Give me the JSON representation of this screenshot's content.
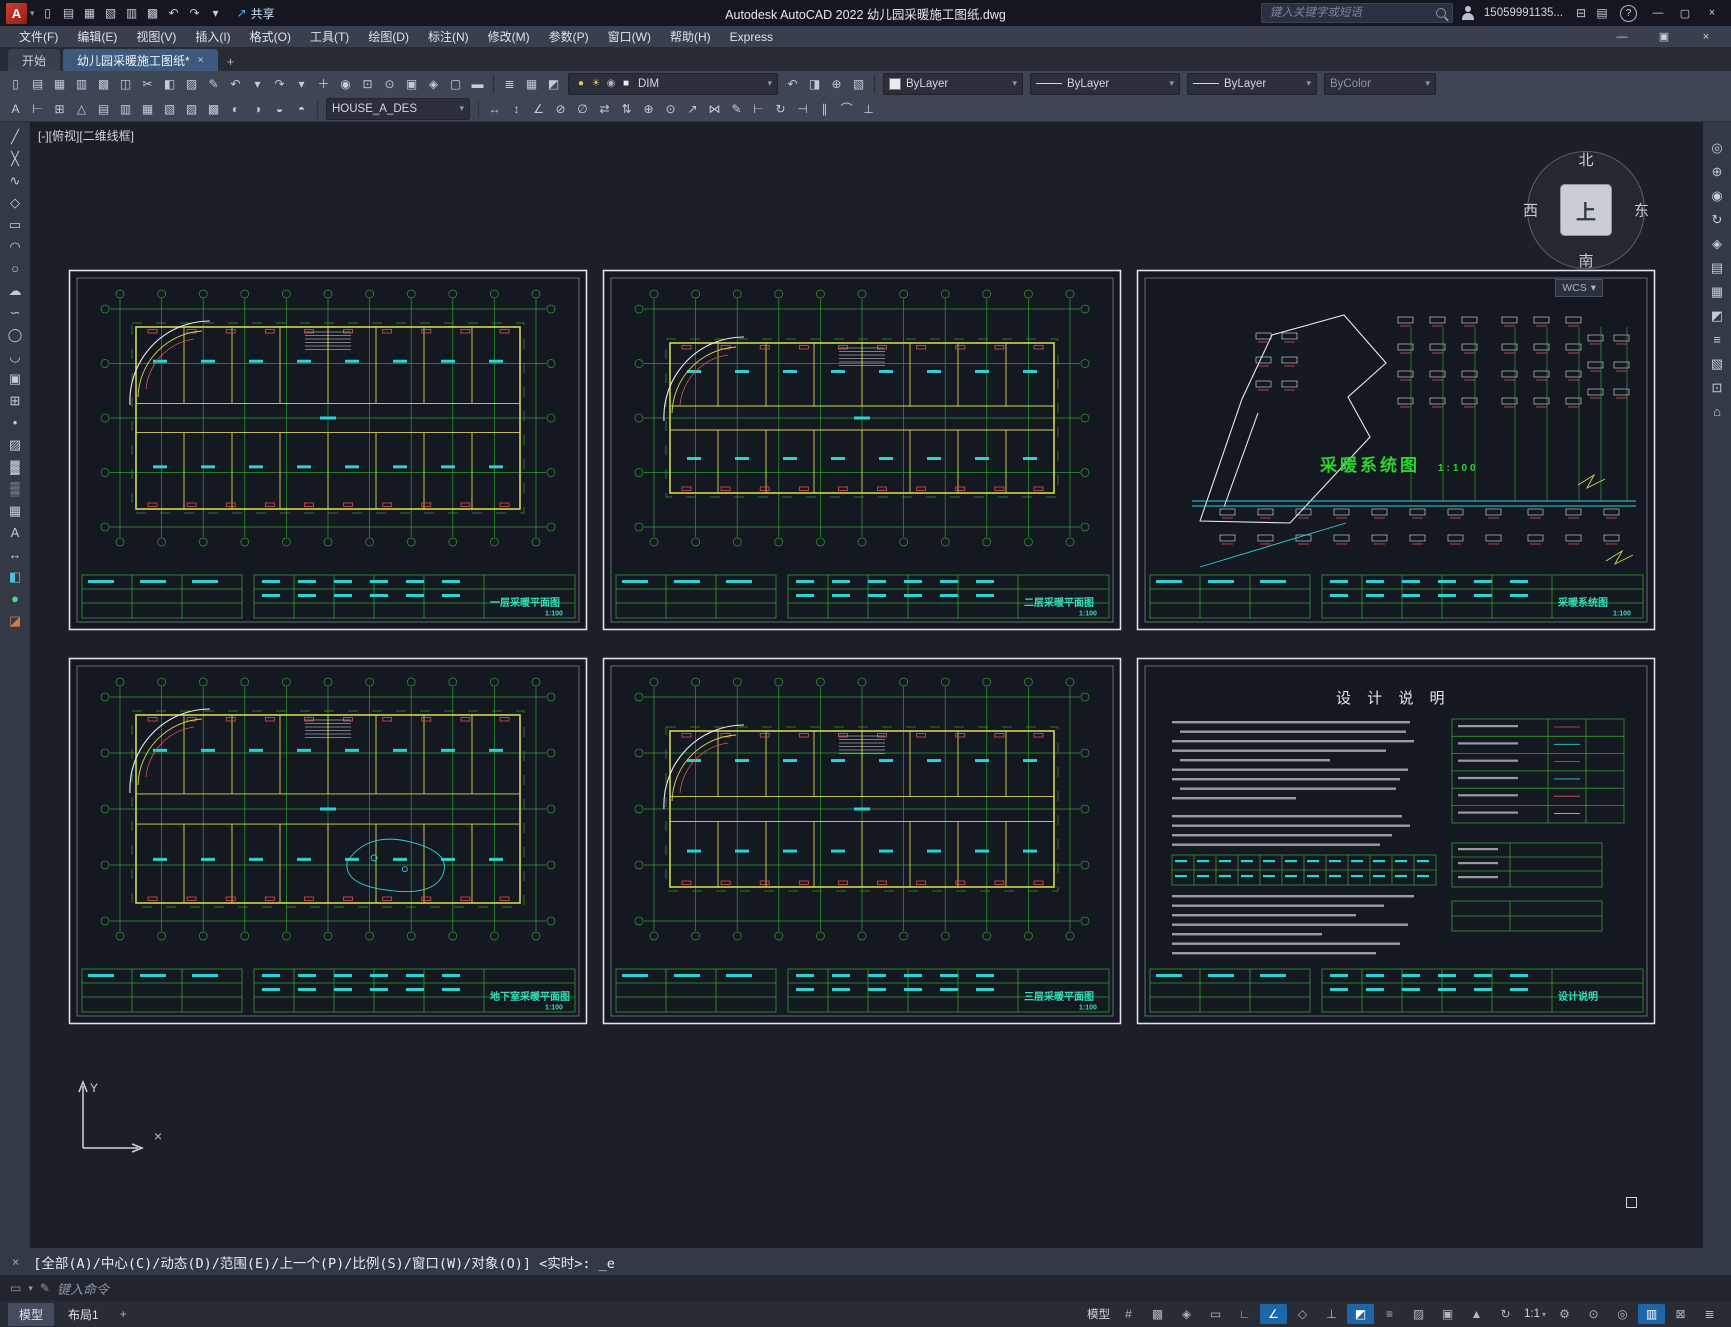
{
  "titlebar": {
    "logo": "A",
    "quick_access": [
      {
        "n": "new-file-icon",
        "g": "▯"
      },
      {
        "n": "open-file-icon",
        "g": "▤"
      },
      {
        "n": "save-icon",
        "g": "▦"
      },
      {
        "n": "save-as-icon",
        "g": "▧"
      },
      {
        "n": "plot-icon",
        "g": "▥"
      },
      {
        "n": "plot-preview-icon",
        "g": "▩"
      },
      {
        "n": "undo-icon",
        "g": "↶"
      },
      {
        "n": "redo-icon",
        "g": "↷"
      },
      {
        "n": "quick-access-dropdown-icon",
        "g": "▾"
      }
    ],
    "share_label": "共享",
    "title": "Autodesk AutoCAD 2022   幼儿园采暖施工图纸.dwg",
    "search_placeholder": "键入关键字或短语",
    "account": "15059991135...",
    "help": "?",
    "extra_icons": [
      {
        "n": "cart-icon",
        "g": "⊟"
      },
      {
        "n": "apps-icon",
        "g": "▤"
      }
    ],
    "window_icons": [
      {
        "n": "window-minimize-icon",
        "g": "—"
      },
      {
        "n": "window-maximize-icon",
        "g": "▢"
      },
      {
        "n": "window-close-icon",
        "g": "×"
      }
    ]
  },
  "menubar": {
    "items": [
      "文件(F)",
      "编辑(E)",
      "视图(V)",
      "插入(I)",
      "格式(O)",
      "工具(T)",
      "绘图(D)",
      "标注(N)",
      "修改(M)",
      "参数(P)",
      "窗口(W)",
      "帮助(H)",
      "Express"
    ],
    "docwin_icons": [
      {
        "n": "doc-minimize-icon",
        "g": "—"
      },
      {
        "n": "doc-restore-icon",
        "g": "▣"
      },
      {
        "n": "doc-close-icon",
        "g": "×"
      }
    ]
  },
  "filetabs": {
    "start": "开始",
    "doc": "幼儿园采暖施工图纸*",
    "close": "×",
    "add": "+"
  },
  "toolbars": {
    "row1_group1": [
      {
        "n": "qnew-icon",
        "g": "▯"
      },
      {
        "n": "open-icon",
        "g": "▤"
      },
      {
        "n": "qsave-icon",
        "g": "▦"
      },
      {
        "n": "plot-icon",
        "g": "▥"
      },
      {
        "n": "plot-preview-icon",
        "g": "▩"
      },
      {
        "n": "publish-icon",
        "g": "◫"
      },
      {
        "n": "cut-icon",
        "g": "✂"
      },
      {
        "n": "copy-icon",
        "g": "◧"
      },
      {
        "n": "paste-icon",
        "g": "▨"
      },
      {
        "n": "match-properties-icon",
        "g": "✎"
      },
      {
        "n": "undo-icon",
        "g": "↶"
      },
      {
        "n": "undo-dropdown-icon",
        "g": "▾"
      },
      {
        "n": "redo-icon",
        "g": "↷"
      },
      {
        "n": "redo-dropdown-icon",
        "g": "▾"
      },
      {
        "n": "pan-icon",
        "g": "＋"
      },
      {
        "n": "zoom-realtime-icon",
        "g": "◉"
      },
      {
        "n": "zoom-window-icon",
        "g": "⊡"
      },
      {
        "n": "zoom-previous-icon",
        "g": "⊙"
      },
      {
        "n": "properties-palette-icon",
        "g": "▣"
      },
      {
        "n": "design-center-icon",
        "g": "◈"
      },
      {
        "n": "tool-palettes-icon",
        "g": "▢"
      },
      {
        "n": "sheet-set-manager-icon",
        "g": "▬"
      }
    ],
    "row1_group2": [
      {
        "n": "layer-properties-icon",
        "g": "≣"
      },
      {
        "n": "layer-states-icon",
        "g": "▦"
      },
      {
        "n": "layer-isolate-icon",
        "g": "◩"
      }
    ],
    "layer_field": {
      "layer": "DIM",
      "icons": [
        {
          "n": "layer-on-icon",
          "g": "●",
          "c": "#e8c84a"
        },
        {
          "n": "layer-sun-icon",
          "g": "☀",
          "c": "#e8c84a"
        },
        {
          "n": "layer-lock-icon",
          "g": "◉",
          "c": "#aab2bf"
        },
        {
          "n": "layer-color-swatch",
          "g": "■",
          "c": "#e8eaec"
        }
      ]
    },
    "row1_group3": [
      {
        "n": "layer-previous-icon",
        "g": "↶"
      },
      {
        "n": "layer-unlock-icon",
        "g": "◨"
      },
      {
        "n": "make-current-layer-icon",
        "g": "⊕"
      },
      {
        "n": "layer-walk-icon",
        "g": "▧"
      }
    ],
    "properties": {
      "color": "ByLayer",
      "linetype": "ByLayer",
      "lineweight": "ByLayer",
      "plotstyle": "ByColor"
    },
    "row2_group1": [
      {
        "n": "text-style-icon",
        "g": "A"
      },
      {
        "n": "dimension-style-icon",
        "g": "⊢"
      },
      {
        "n": "table-style-icon",
        "g": "⊞"
      },
      {
        "n": "multileader-style-icon",
        "g": "△"
      },
      {
        "n": "point-style-icon",
        "g": "▤"
      },
      {
        "n": "region-icon",
        "g": "▥"
      },
      {
        "n": "boundary-icon",
        "g": "▦"
      },
      {
        "n": "group-icon",
        "g": "▧"
      },
      {
        "n": "ungroup-icon",
        "g": "▨"
      },
      {
        "n": "measure-icon",
        "g": "▩"
      },
      {
        "n": "divide-icon",
        "g": "◐"
      },
      {
        "n": "array-icon",
        "g": "◑"
      },
      {
        "n": "offset-icon",
        "g": "◒"
      },
      {
        "n": "mirror-icon",
        "g": "◓"
      }
    ],
    "style_field": {
      "value": "HOUSE_A_DES"
    },
    "row2_group2": [
      {
        "n": "dimension-linear-icon",
        "g": "↔"
      },
      {
        "n": "dimension-aligned-icon",
        "g": "↕"
      },
      {
        "n": "dimension-angular-icon",
        "g": "∠"
      },
      {
        "n": "dimension-radius-icon",
        "g": "⊘"
      },
      {
        "n": "dimension-diameter-icon",
        "g": "∅"
      },
      {
        "n": "dimension-continue-icon",
        "g": "⇄"
      },
      {
        "n": "dimension-baseline-icon",
        "g": "⇅"
      },
      {
        "n": "tolerance-icon",
        "g": "⊕"
      },
      {
        "n": "center-mark-icon",
        "g": "⊙"
      },
      {
        "n": "leader-icon",
        "g": "↗"
      },
      {
        "n": "quick-dimension-icon",
        "g": "⋈"
      },
      {
        "n": "dimension-edit-icon",
        "g": "✎"
      },
      {
        "n": "dimension-text-edit-icon",
        "g": "⊢"
      },
      {
        "n": "dimension-update-icon",
        "g": "↻"
      },
      {
        "n": "dimension-break-icon",
        "g": "⊣"
      },
      {
        "n": "dimension-space-icon",
        "g": "∥"
      },
      {
        "n": "jogged-dimension-icon",
        "g": "⌒"
      },
      {
        "n": "inspect-dimension-icon",
        "g": "⊥"
      }
    ]
  },
  "left_toolbar": [
    {
      "n": "line-icon",
      "g": "╱"
    },
    {
      "n": "construction-line-icon",
      "g": "╳"
    },
    {
      "n": "polyline-icon",
      "g": "∿"
    },
    {
      "n": "polygon-icon",
      "g": "◇"
    },
    {
      "n": "rectangle-icon",
      "g": "▭"
    },
    {
      "n": "arc-icon",
      "g": "◠"
    },
    {
      "n": "circle-icon",
      "g": "○"
    },
    {
      "n": "revision-cloud-icon",
      "g": "☁"
    },
    {
      "n": "spline-icon",
      "g": "∽"
    },
    {
      "n": "ellipse-icon",
      "g": "◯"
    },
    {
      "n": "ellipse-arc-icon",
      "g": "◡"
    },
    {
      "n": "insert-block-icon",
      "g": "▣"
    },
    {
      "n": "create-block-icon",
      "g": "⊞"
    },
    {
      "n": "point-icon",
      "g": "•"
    },
    {
      "n": "hatch-icon",
      "g": "▨"
    },
    {
      "n": "gradient-icon",
      "g": "▓"
    },
    {
      "n": "region-icon",
      "g": "▒"
    },
    {
      "n": "table-icon",
      "g": "▦"
    },
    {
      "n": "multiline-text-icon",
      "g": "A"
    },
    {
      "n": "dimension-icon",
      "g": "↔"
    },
    {
      "n": "palette-icon",
      "g": "◧",
      "c": "#49c0d8"
    },
    {
      "n": "marker-icon",
      "g": "●",
      "c": "#49d87e"
    },
    {
      "n": "eraser-icon",
      "g": "◪",
      "c": "#d87a49"
    }
  ],
  "right_toolbar": [
    {
      "n": "steering-wheel-icon",
      "g": "◎"
    },
    {
      "n": "pan-hand-icon",
      "g": "⊕"
    },
    {
      "n": "zoom-icon",
      "g": "◉"
    },
    {
      "n": "orbit-icon",
      "g": "↻"
    },
    {
      "n": "show-motion-icon",
      "g": "◈"
    },
    {
      "n": "named-views-icon",
      "g": "▤"
    },
    {
      "n": "view-controls-icon",
      "g": "▦"
    },
    {
      "n": "anchor-left-icon",
      "g": "◩"
    },
    {
      "n": "overflow-icon",
      "g": "≡"
    },
    {
      "n": "layer-panel-icon",
      "g": "▧"
    },
    {
      "n": "grid-display-icon",
      "g": "⊡"
    },
    {
      "n": "home-view-icon",
      "g": "⌂"
    }
  ],
  "canvas": {
    "viewport_label": "[-][俯视][二维线框]",
    "compass": {
      "n": "北",
      "s": "南",
      "e": "东",
      "w": "西",
      "top": "上",
      "wcs": "WCS"
    },
    "ucs_y": "Y",
    "crosshair": "×"
  },
  "drawings": {
    "panels": [
      {
        "id": "plan-1f",
        "type": "plan",
        "title": "一层采暖平面图",
        "scale": "1:100",
        "arc": true,
        "pool": false,
        "narrow": false
      },
      {
        "id": "plan-2f",
        "type": "plan",
        "title": "二层采暖平面图",
        "scale": "1:100",
        "arc": true,
        "pool": false,
        "narrow": true
      },
      {
        "id": "system",
        "type": "system",
        "title": "采暖系统图",
        "scale": "1:100",
        "label": "采暖系统图",
        "label_scale": "1:100"
      },
      {
        "id": "plan-basement",
        "type": "plan",
        "title": "地下室采暖平面图",
        "scale": "1:100",
        "arc": true,
        "pool": true,
        "narrow": false
      },
      {
        "id": "plan-3f",
        "type": "plan",
        "title": "三层采暖平面图",
        "scale": "1:100",
        "arc": true,
        "pool": false,
        "narrow": true
      },
      {
        "id": "notes",
        "type": "notes",
        "title": "设计说明",
        "heading": "设 计 说 明"
      }
    ]
  },
  "commandline": {
    "history": "[全部(A)/中心(C)/动态(D)/范围(E)/上一个(P)/比例(S)/窗口(W)/对象(O)] <实时>:  _e",
    "placeholder": "键入命令"
  },
  "statusbar": {
    "model_tab": "模型",
    "layout_tab": "布局1",
    "add": "+",
    "icons": [
      {
        "n": "model-space-badge",
        "t": "模型"
      },
      {
        "n": "grid-icon",
        "g": "#"
      },
      {
        "n": "snap-icon",
        "g": "▩"
      },
      {
        "n": "infer-constraints-icon",
        "g": "◈"
      },
      {
        "n": "dynamic-input-icon",
        "g": "▭"
      },
      {
        "n": "ortho-icon",
        "g": "∟"
      },
      {
        "n": "polar-tracking-icon",
        "g": "∠",
        "a": true
      },
      {
        "n": "isometric-drafting-icon",
        "g": "◇"
      },
      {
        "n": "object-snap-tracking-icon",
        "g": "⊥"
      },
      {
        "n": "object-snap-icon",
        "g": "◩",
        "a": true
      },
      {
        "n": "lineweight-icon",
        "g": "≡"
      },
      {
        "n": "transparency-icon",
        "g": "▨"
      },
      {
        "n": "selection-cycling-icon",
        "g": "▣"
      },
      {
        "n": "annotation-visibility-icon",
        "g": "▲"
      },
      {
        "n": "autoscale-icon",
        "g": "↻"
      },
      {
        "n": "annotation-scale-label",
        "t": "1:1",
        "dd": true
      },
      {
        "n": "workspace-switching-icon",
        "g": "⚙"
      },
      {
        "n": "annotation-monitor-icon",
        "g": "⊙"
      },
      {
        "n": "isolate-objects-icon",
        "g": "◎"
      },
      {
        "n": "hardware-acceleration-icon",
        "g": "▥",
        "a": true
      },
      {
        "n": "clean-screen-icon",
        "g": "⊠"
      },
      {
        "n": "customization-icon",
        "g": "≣"
      }
    ]
  }
}
